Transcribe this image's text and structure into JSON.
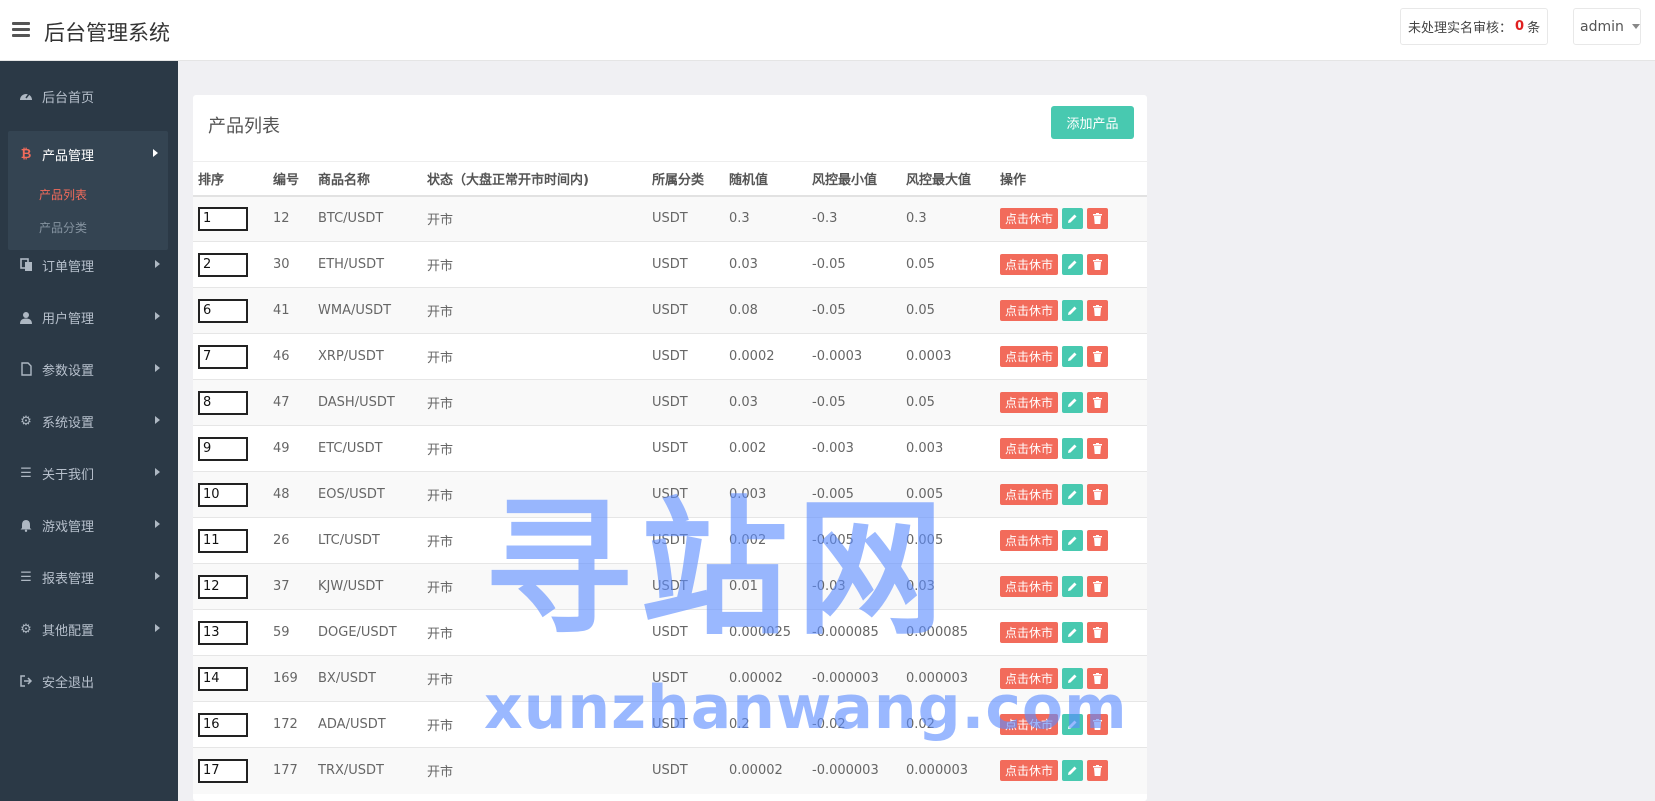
{
  "header": {
    "title": "后台管理系统",
    "review_label": "未处理实名审核：",
    "review_count": "0",
    "review_unit": "条",
    "user": "admin"
  },
  "sidebar": {
    "home": "后台首页",
    "product": "产品管理",
    "product_list": "产品列表",
    "product_category": "产品分类",
    "orders": "订单管理",
    "users": "用户管理",
    "params": "参数设置",
    "system": "系统设置",
    "about": "关于我们",
    "games": "游戏管理",
    "reports": "报表管理",
    "other": "其他配置",
    "logout": "安全退出"
  },
  "panel": {
    "title": "产品列表",
    "add_button": "添加产品"
  },
  "table": {
    "headers": {
      "sort": "排序",
      "id": "编号",
      "name": "商品名称",
      "status": "状态（大盘正常开市时间内)",
      "category": "所属分类",
      "random": "随机值",
      "min": "风控最小值",
      "max": "风控最大值",
      "ops": "操作"
    },
    "close_label": "点击休市",
    "rows": [
      {
        "sort": "1",
        "id": "12",
        "name": "BTC/USDT",
        "status": "开市",
        "category": "USDT",
        "random": "0.3",
        "min": "-0.3",
        "max": "0.3"
      },
      {
        "sort": "2",
        "id": "30",
        "name": "ETH/USDT",
        "status": "开市",
        "category": "USDT",
        "random": "0.03",
        "min": "-0.05",
        "max": "0.05"
      },
      {
        "sort": "6",
        "id": "41",
        "name": "WMA/USDT",
        "status": "开市",
        "category": "USDT",
        "random": "0.08",
        "min": "-0.05",
        "max": "0.05"
      },
      {
        "sort": "7",
        "id": "46",
        "name": "XRP/USDT",
        "status": "开市",
        "category": "USDT",
        "random": "0.0002",
        "min": "-0.0003",
        "max": "0.0003"
      },
      {
        "sort": "8",
        "id": "47",
        "name": "DASH/USDT",
        "status": "开市",
        "category": "USDT",
        "random": "0.03",
        "min": "-0.05",
        "max": "0.05"
      },
      {
        "sort": "9",
        "id": "49",
        "name": "ETC/USDT",
        "status": "开市",
        "category": "USDT",
        "random": "0.002",
        "min": "-0.003",
        "max": "0.003"
      },
      {
        "sort": "10",
        "id": "48",
        "name": "EOS/USDT",
        "status": "开市",
        "category": "USDT",
        "random": "0.003",
        "min": "-0.005",
        "max": "0.005"
      },
      {
        "sort": "11",
        "id": "26",
        "name": "LTC/USDT",
        "status": "开市",
        "category": "USDT",
        "random": "0.002",
        "min": "-0.005",
        "max": "0.005"
      },
      {
        "sort": "12",
        "id": "37",
        "name": "KJW/USDT",
        "status": "开市",
        "category": "USDT",
        "random": "0.01",
        "min": "-0.03",
        "max": "0.03"
      },
      {
        "sort": "13",
        "id": "59",
        "name": "DOGE/USDT",
        "status": "开市",
        "category": "USDT",
        "random": "0.000025",
        "min": "-0.000085",
        "max": "0.000085"
      },
      {
        "sort": "14",
        "id": "169",
        "name": "BX/USDT",
        "status": "开市",
        "category": "USDT",
        "random": "0.00002",
        "min": "-0.000003",
        "max": "0.000003"
      },
      {
        "sort": "16",
        "id": "172",
        "name": "ADA/USDT",
        "status": "开市",
        "category": "USDT",
        "random": "0.2",
        "min": "-0.02",
        "max": "0.02"
      },
      {
        "sort": "17",
        "id": "177",
        "name": "TRX/USDT",
        "status": "开市",
        "category": "USDT",
        "random": "0.00002",
        "min": "-0.000003",
        "max": "0.000003"
      }
    ]
  },
  "watermark": {
    "cn": "寻站网",
    "en": "xunzhanwang.com"
  },
  "colors": {
    "sidebar_bg": "#2b3946",
    "accent_teal": "#48c9b0",
    "accent_red": "#f26b5b",
    "watermark": "#5c8cff"
  }
}
